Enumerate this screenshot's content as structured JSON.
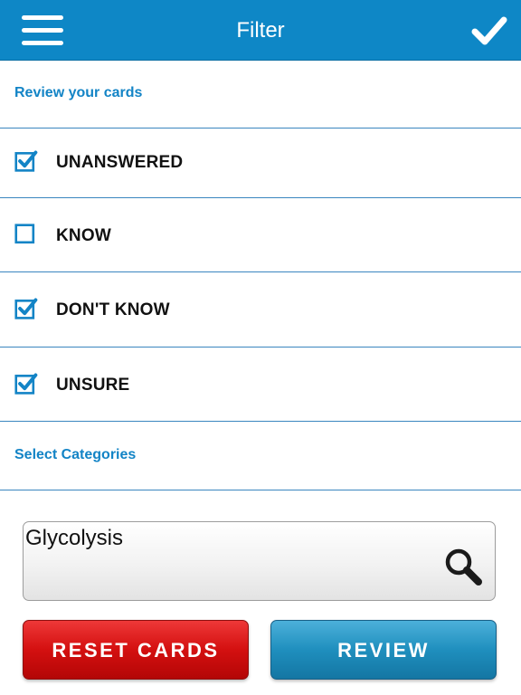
{
  "nav": {
    "title": "Filter",
    "menu_icon": "hamburger-icon",
    "done_icon": "checkmark-icon",
    "bar_color": "#0e87c6"
  },
  "review_section": {
    "header": "Review your cards"
  },
  "filters": [
    {
      "label": "UNANSWERED",
      "checked": true
    },
    {
      "label": "KNOW",
      "checked": false
    },
    {
      "label": "DON'T KNOW",
      "checked": true
    },
    {
      "label": "UNSURE",
      "checked": true
    }
  ],
  "categories_section": {
    "header": "Select Categories"
  },
  "search": {
    "value": "Glycolysis",
    "icon": "magnifier-icon"
  },
  "buttons": {
    "reset_label": "RESET CARDS",
    "review_label": "REVIEW",
    "reset_color": "#d41010",
    "review_color": "#1f8fbe"
  },
  "colors": {
    "accent": "#1384c6",
    "divider": "#3a86bf"
  }
}
